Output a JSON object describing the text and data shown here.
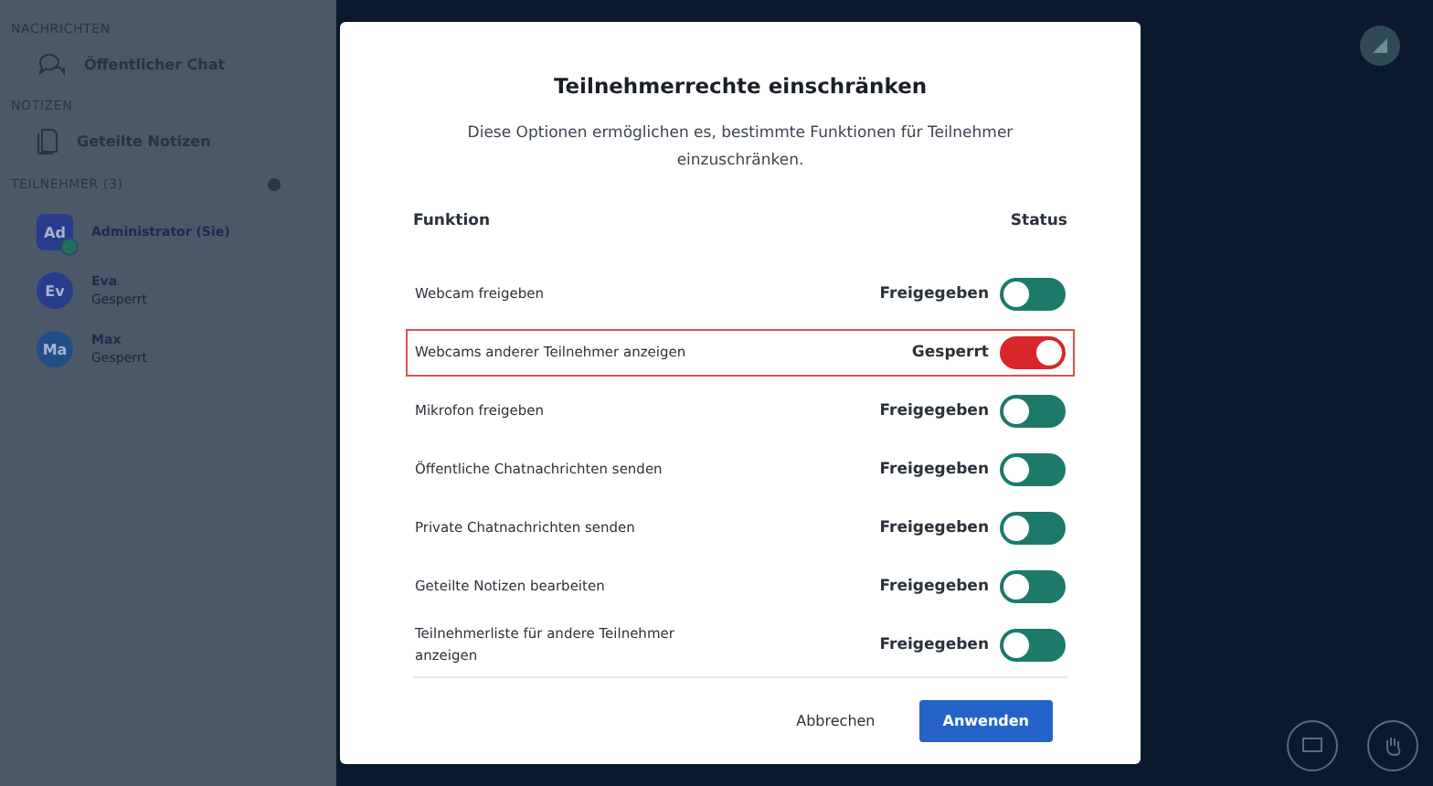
{
  "sidebar": {
    "sections": [
      {
        "heading": "NACHRICHTEN",
        "items": [
          {
            "kind": "chat",
            "label": "Öffentlicher Chat"
          }
        ]
      },
      {
        "heading": "NOTIZEN",
        "items": [
          {
            "kind": "notes",
            "label": "Geteilte Notizen"
          }
        ]
      }
    ],
    "participants": {
      "heading": "TEILNEHMER (3)",
      "items": [
        {
          "initials": "Ad",
          "name": "Administrator (Sie)",
          "moderator": true,
          "color": "#283c8c"
        },
        {
          "initials": "Ev",
          "name": "Eva",
          "status": "Gesperrt",
          "moderator": false,
          "color": "#283c8c"
        },
        {
          "initials": "Ma",
          "name": "Max",
          "status": "Gesperrt",
          "moderator": false,
          "color": "#1f4f86"
        }
      ]
    }
  },
  "dialog": {
    "title": "Teilnehmerrechte einschränken",
    "description": "Diese Optionen ermöglichen es, bestimmte Funktionen für Teilnehmer einzuschränken.",
    "columns": [
      "Funktion",
      "Status"
    ],
    "rows": [
      {
        "label": "Webcam freigeben",
        "status": "Freigegeben",
        "locked": false,
        "highlighted": false
      },
      {
        "label": "Webcams anderer Teilnehmer anzeigen",
        "status": "Gesperrt",
        "locked": true,
        "highlighted": true
      },
      {
        "label": "Mikrofon freigeben",
        "status": "Freigegeben",
        "locked": false,
        "highlighted": false
      },
      {
        "label": "Öffentliche Chatnachrichten senden",
        "status": "Freigegeben",
        "locked": false,
        "highlighted": false
      },
      {
        "label": "Private Chatnachrichten senden",
        "status": "Freigegeben",
        "locked": false,
        "highlighted": false
      },
      {
        "label": "Geteilte Notizen bearbeiten",
        "status": "Freigegeben",
        "locked": false,
        "highlighted": false
      },
      {
        "label": "Teilnehmerliste für andere Teilnehmer anzeigen",
        "status": "Freigegeben",
        "locked": false,
        "highlighted": false
      }
    ],
    "buttons": {
      "cancel": "Abbrechen",
      "apply": "Anwenden"
    }
  }
}
